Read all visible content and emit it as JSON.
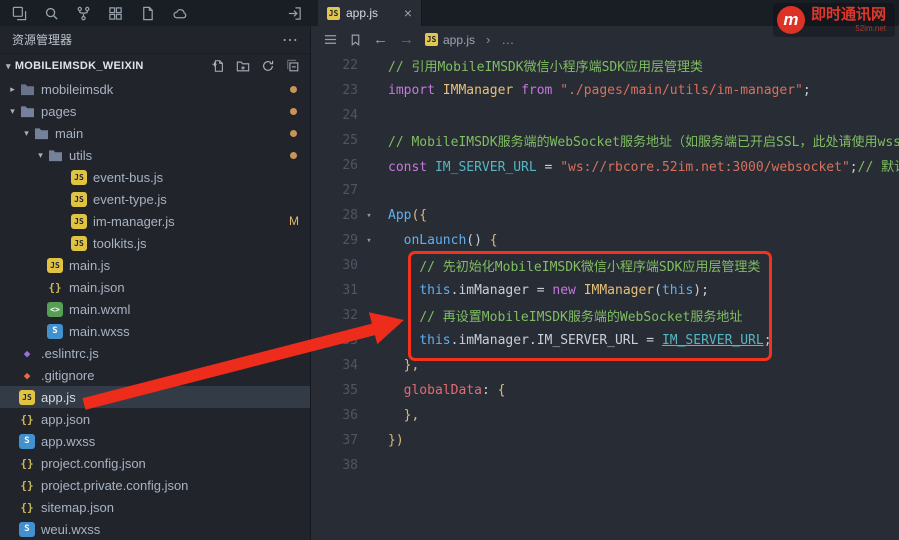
{
  "titlebar": {
    "icons": [
      "explorer-icon",
      "search-icon",
      "git-fork-icon",
      "extensions-grid-icon",
      "document-icon",
      "cloud-icon"
    ],
    "right_icon": "plugin-install-icon"
  },
  "tab": {
    "label": "app.js",
    "close": "×"
  },
  "breadcrumb": {
    "icons": [
      "menu-icon",
      "bookmark-icon",
      "back-arrow-icon",
      "forward-arrow-icon"
    ],
    "file": "app.js",
    "separator": "›",
    "ellipsis": "…"
  },
  "icon_glyphs": {
    "js": "JS",
    "json": "{}",
    "wxml": "<>",
    "wxss": "S",
    "eslint": "◆",
    "git": "◆"
  },
  "sidebar": {
    "header": {
      "title": "资源管理器",
      "more": "⋯"
    },
    "chevrons": {
      "expanded": "▾",
      "collapsed": "▸"
    },
    "section": {
      "label": "MOBILEIMSDK_WEIXIN",
      "actions": [
        "new-file-icon",
        "new-folder-icon",
        "refresh-icon",
        "collapse-all-icon"
      ]
    },
    "tree": [
      {
        "label": "mobileimsdk",
        "icon": "folder-icon",
        "type": "folder",
        "expanded": false,
        "indent": 1,
        "dot": true
      },
      {
        "label": "pages",
        "icon": "folder-open-icon",
        "type": "folder",
        "expanded": true,
        "indent": 1,
        "dot": true
      },
      {
        "label": "main",
        "icon": "folder-open-icon",
        "type": "folder",
        "expanded": true,
        "indent": 2,
        "dot": true
      },
      {
        "label": "utils",
        "icon": "folder-open-icon",
        "type": "folder",
        "expanded": true,
        "indent": 3,
        "dot": true
      },
      {
        "label": "event-bus.js",
        "icon": "js-file-icon",
        "type": "file",
        "indent": 4
      },
      {
        "label": "event-type.js",
        "icon": "js-file-icon",
        "type": "file",
        "indent": 4
      },
      {
        "label": "im-manager.js",
        "icon": "js-file-icon",
        "type": "file",
        "indent": 4,
        "badge": "M"
      },
      {
        "label": "toolkits.js",
        "icon": "js-file-icon",
        "type": "file",
        "indent": 4
      },
      {
        "label": "main.js",
        "icon": "js-file-icon",
        "type": "file",
        "indent": 3
      },
      {
        "label": "main.json",
        "icon": "json-file-icon",
        "type": "file",
        "indent": 3
      },
      {
        "label": "main.wxml",
        "icon": "wxml-file-icon",
        "type": "file",
        "indent": 3
      },
      {
        "label": "main.wxss",
        "icon": "wxss-file-icon",
        "type": "file",
        "indent": 3
      },
      {
        "label": ".eslintrc.js",
        "icon": "eslint-icon",
        "type": "file",
        "indent": 1
      },
      {
        "label": ".gitignore",
        "icon": "git-icon",
        "type": "file",
        "indent": 1
      },
      {
        "label": "app.js",
        "icon": "js-file-icon",
        "type": "file",
        "indent": 1,
        "selected": true
      },
      {
        "label": "app.json",
        "icon": "json-file-icon",
        "type": "file",
        "indent": 1
      },
      {
        "label": "app.wxss",
        "icon": "wxss-file-icon",
        "type": "file",
        "indent": 1
      },
      {
        "label": "project.config.json",
        "icon": "json-file-icon",
        "type": "file",
        "indent": 1
      },
      {
        "label": "project.private.config.json",
        "icon": "json-file-icon",
        "type": "file",
        "indent": 1
      },
      {
        "label": "sitemap.json",
        "icon": "json-file-icon",
        "type": "file",
        "indent": 1
      },
      {
        "label": "weui.wxss",
        "icon": "wxss-file-icon",
        "type": "file",
        "indent": 1
      }
    ]
  },
  "editor": {
    "fold_glyph": "▾",
    "lines": [
      {
        "n": 22,
        "fold": false,
        "tokens": [
          [
            "c",
            "// 引用MobileIMSDK微信小程序端SDK应用层管理类"
          ]
        ]
      },
      {
        "n": 23,
        "fold": false,
        "tokens": [
          [
            "k",
            "import"
          ],
          [
            "p",
            " "
          ],
          [
            "cl",
            "IMManager"
          ],
          [
            "p",
            " "
          ],
          [
            "k",
            "from"
          ],
          [
            "p",
            " "
          ],
          [
            "s",
            "\"./pages/main/utils/im-manager\""
          ],
          [
            "p",
            ";"
          ]
        ]
      },
      {
        "n": 24,
        "fold": false,
        "tokens": []
      },
      {
        "n": 25,
        "fold": false,
        "tokens": [
          [
            "c",
            "// MobileIMSDK服务端的WebSocket服务地址（如服务端已开启SSL，此处请使用wss）"
          ]
        ]
      },
      {
        "n": 26,
        "fold": false,
        "tokens": [
          [
            "k",
            "const"
          ],
          [
            "p",
            " "
          ],
          [
            "cn",
            "IM_SERVER_URL"
          ],
          [
            "p",
            " = "
          ],
          [
            "s",
            "\"ws://rbcore.52im.net:3000/websocket\""
          ],
          [
            "p",
            ";"
          ],
          [
            "c",
            "// 默认"
          ]
        ]
      },
      {
        "n": 27,
        "fold": false,
        "tokens": []
      },
      {
        "n": 28,
        "fold": true,
        "tokens": [
          [
            "en",
            "App"
          ],
          [
            "br",
            "({"
          ]
        ]
      },
      {
        "n": 29,
        "fold": true,
        "tokens": [
          [
            "p",
            "  "
          ],
          [
            "en",
            "onLaunch"
          ],
          [
            "p",
            "() "
          ],
          [
            "br",
            "{"
          ]
        ]
      },
      {
        "n": 30,
        "fold": false,
        "tokens": [
          [
            "p",
            "    "
          ],
          [
            "c",
            "// 先初始化MobileIMSDK微信小程序端SDK应用层管理类"
          ]
        ]
      },
      {
        "n": 31,
        "fold": false,
        "tokens": [
          [
            "p",
            "    "
          ],
          [
            "th",
            "this"
          ],
          [
            "p",
            ".imManager = "
          ],
          [
            "k",
            "new"
          ],
          [
            "p",
            " "
          ],
          [
            "cl",
            "IMManager"
          ],
          [
            "p",
            "("
          ],
          [
            "th",
            "this"
          ],
          [
            "p",
            ");"
          ]
        ]
      },
      {
        "n": 32,
        "fold": false,
        "tokens": [
          [
            "p",
            "    "
          ],
          [
            "c",
            "// 再设置MobileIMSDK服务端的WebSocket服务地址"
          ]
        ]
      },
      {
        "n": 33,
        "fold": false,
        "tokens": [
          [
            "p",
            "    "
          ],
          [
            "th",
            "this"
          ],
          [
            "p",
            ".imManager.IM_SERVER_URL = "
          ],
          [
            "lk",
            "IM_SERVER_URL"
          ],
          [
            "p",
            ";"
          ]
        ]
      },
      {
        "n": 34,
        "fold": false,
        "tokens": [
          [
            "p",
            "  "
          ],
          [
            "br",
            "},"
          ]
        ]
      },
      {
        "n": 35,
        "fold": false,
        "tokens": [
          [
            "p",
            "  "
          ],
          [
            "pr",
            "globalData"
          ],
          [
            "p",
            ": "
          ],
          [
            "br",
            "{"
          ]
        ]
      },
      {
        "n": 36,
        "fold": false,
        "tokens": [
          [
            "p",
            "  "
          ],
          [
            "br",
            "},"
          ]
        ]
      },
      {
        "n": 37,
        "fold": false,
        "tokens": [
          [
            "br",
            "})"
          ]
        ]
      },
      {
        "n": 38,
        "fold": false,
        "tokens": []
      }
    ]
  },
  "annotations": {
    "box_color": "#f5321c",
    "arrow_color": "#ee2c1c"
  },
  "watermark": {
    "logo_letter": "m",
    "title": "即时通讯网",
    "subtitle": "52im.net"
  },
  "colors": {
    "accent_red": "#f5321c",
    "modified_gold": "#dfb86c",
    "selection_bg": "#333b47"
  }
}
